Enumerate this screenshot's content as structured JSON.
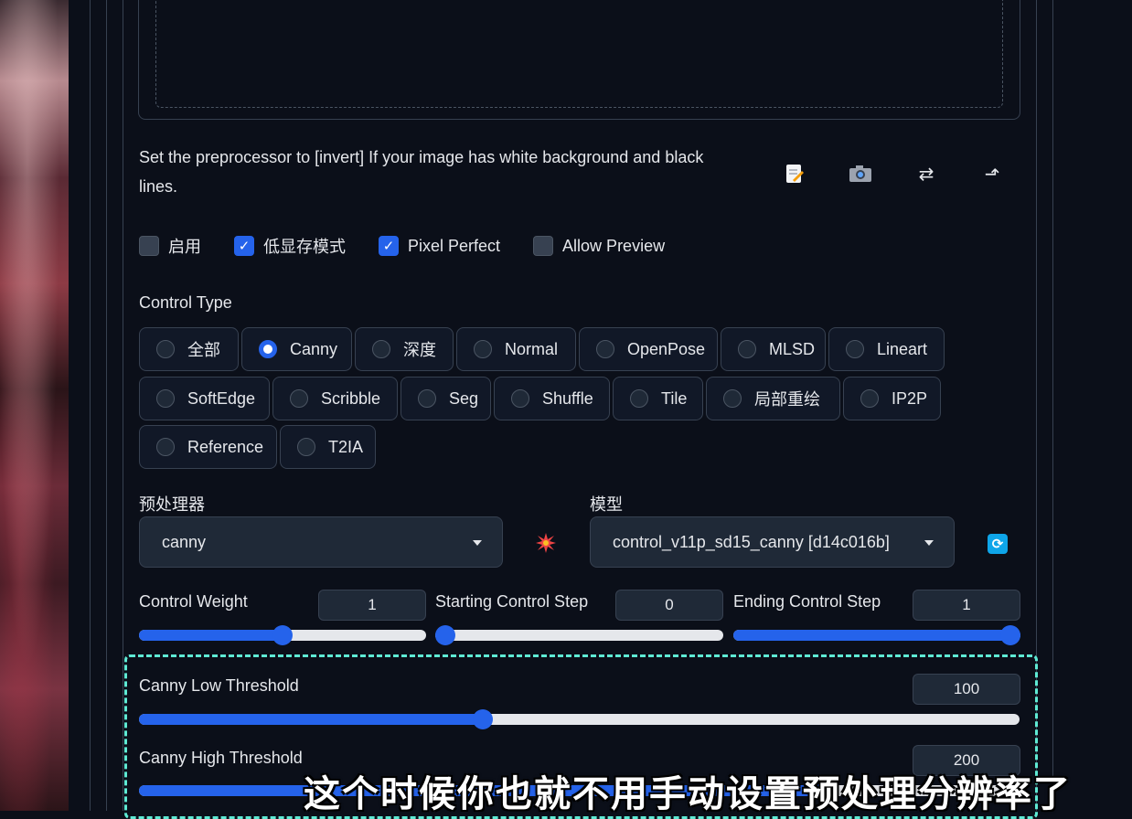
{
  "note": "Set the preprocessor to [invert] If your image has white background and black lines.",
  "tool_icons": [
    "edit-icon",
    "camera-icon",
    "swap-icon",
    "send-icon"
  ],
  "checkboxes": [
    {
      "label": "启用",
      "checked": false
    },
    {
      "label": "低显存模式",
      "checked": true
    },
    {
      "label": "Pixel Perfect",
      "checked": true
    },
    {
      "label": "Allow Preview",
      "checked": false
    }
  ],
  "control_type": {
    "label": "Control Type",
    "options": [
      "全部",
      "Canny",
      "深度",
      "Normal",
      "OpenPose",
      "MLSD",
      "Lineart",
      "SoftEdge",
      "Scribble",
      "Seg",
      "Shuffle",
      "Tile",
      "局部重绘",
      "IP2P",
      "Reference",
      "T2IA"
    ],
    "selected": "Canny"
  },
  "preprocessor": {
    "label": "预处理器",
    "value": "canny"
  },
  "model": {
    "label": "模型",
    "value": "control_v11p_sd15_canny [d14c016b]"
  },
  "control_weight": {
    "label": "Control Weight",
    "value": "1",
    "fraction": 0.5
  },
  "starting_step": {
    "label": "Starting Control Step",
    "value": "0",
    "fraction": 0.0
  },
  "ending_step": {
    "label": "Ending Control Step",
    "value": "1",
    "fraction": 1.0
  },
  "canny_low": {
    "label": "Canny Low Threshold",
    "value": "100",
    "fraction": 0.39
  },
  "canny_high": {
    "label": "Canny High Threshold",
    "value": "200",
    "fraction": 0.78
  },
  "subtitle": "这个时候你也就不用手动设置预处理分辨率了",
  "colors": {
    "accent": "#2563eb",
    "highlight": "#5eead4",
    "background": "#0b0f19"
  }
}
